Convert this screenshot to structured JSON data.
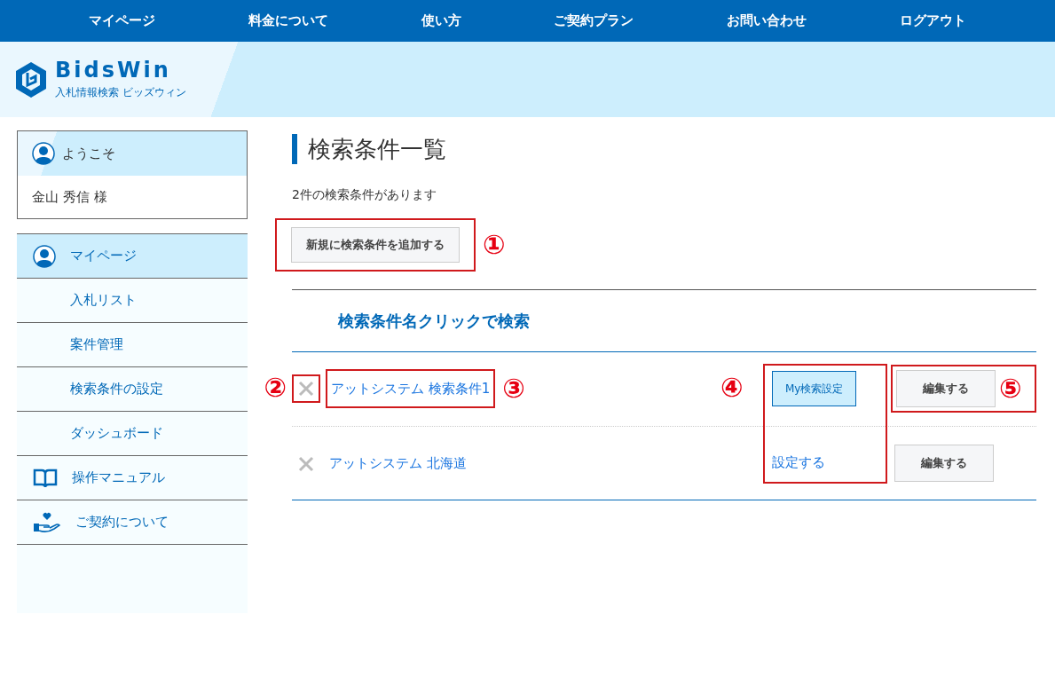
{
  "top_nav": [
    {
      "label": "マイページ"
    },
    {
      "label": "料金について"
    },
    {
      "label": "使い方"
    },
    {
      "label": "ご契約プラン"
    },
    {
      "label": "お問い合わせ"
    },
    {
      "label": "ログアウト"
    }
  ],
  "logo": {
    "name": "BidsWin",
    "tagline": "入札情報検索 ビッズウィン"
  },
  "welcome": {
    "title": "ようこそ",
    "user": "金山 秀信 様"
  },
  "sidebar": {
    "items": [
      {
        "label": "マイページ",
        "kind": "user",
        "selected": true
      },
      {
        "label": "入札リスト",
        "kind": "plain",
        "selected": false
      },
      {
        "label": "案件管理",
        "kind": "plain",
        "selected": false
      },
      {
        "label": "検索条件の設定",
        "kind": "plain",
        "selected": false
      },
      {
        "label": "ダッシュボード",
        "kind": "plain",
        "selected": false
      },
      {
        "label": "操作マニュアル",
        "kind": "book",
        "selected": false
      },
      {
        "label": "ご契約について",
        "kind": "gift",
        "selected": false
      }
    ]
  },
  "page": {
    "title": "検索条件一覧",
    "count_text": "2件の検索条件があります",
    "add_button": {
      "label": "新規に検索条件を追加する",
      "callout": "①"
    },
    "list_heading": "検索条件名クリックで検索",
    "settings_callout": "④",
    "rows": [
      {
        "name": "アットシステム 検索条件1",
        "my_search": {
          "label": "My検索設定",
          "active": true
        },
        "edit_label": "編集する",
        "delete_callout": "②",
        "name_callout": "③",
        "edit_callout": "⑤"
      },
      {
        "name": "アットシステム 北海道",
        "my_search": {
          "label": "設定する",
          "active": false
        },
        "edit_label": "編集する"
      }
    ]
  }
}
